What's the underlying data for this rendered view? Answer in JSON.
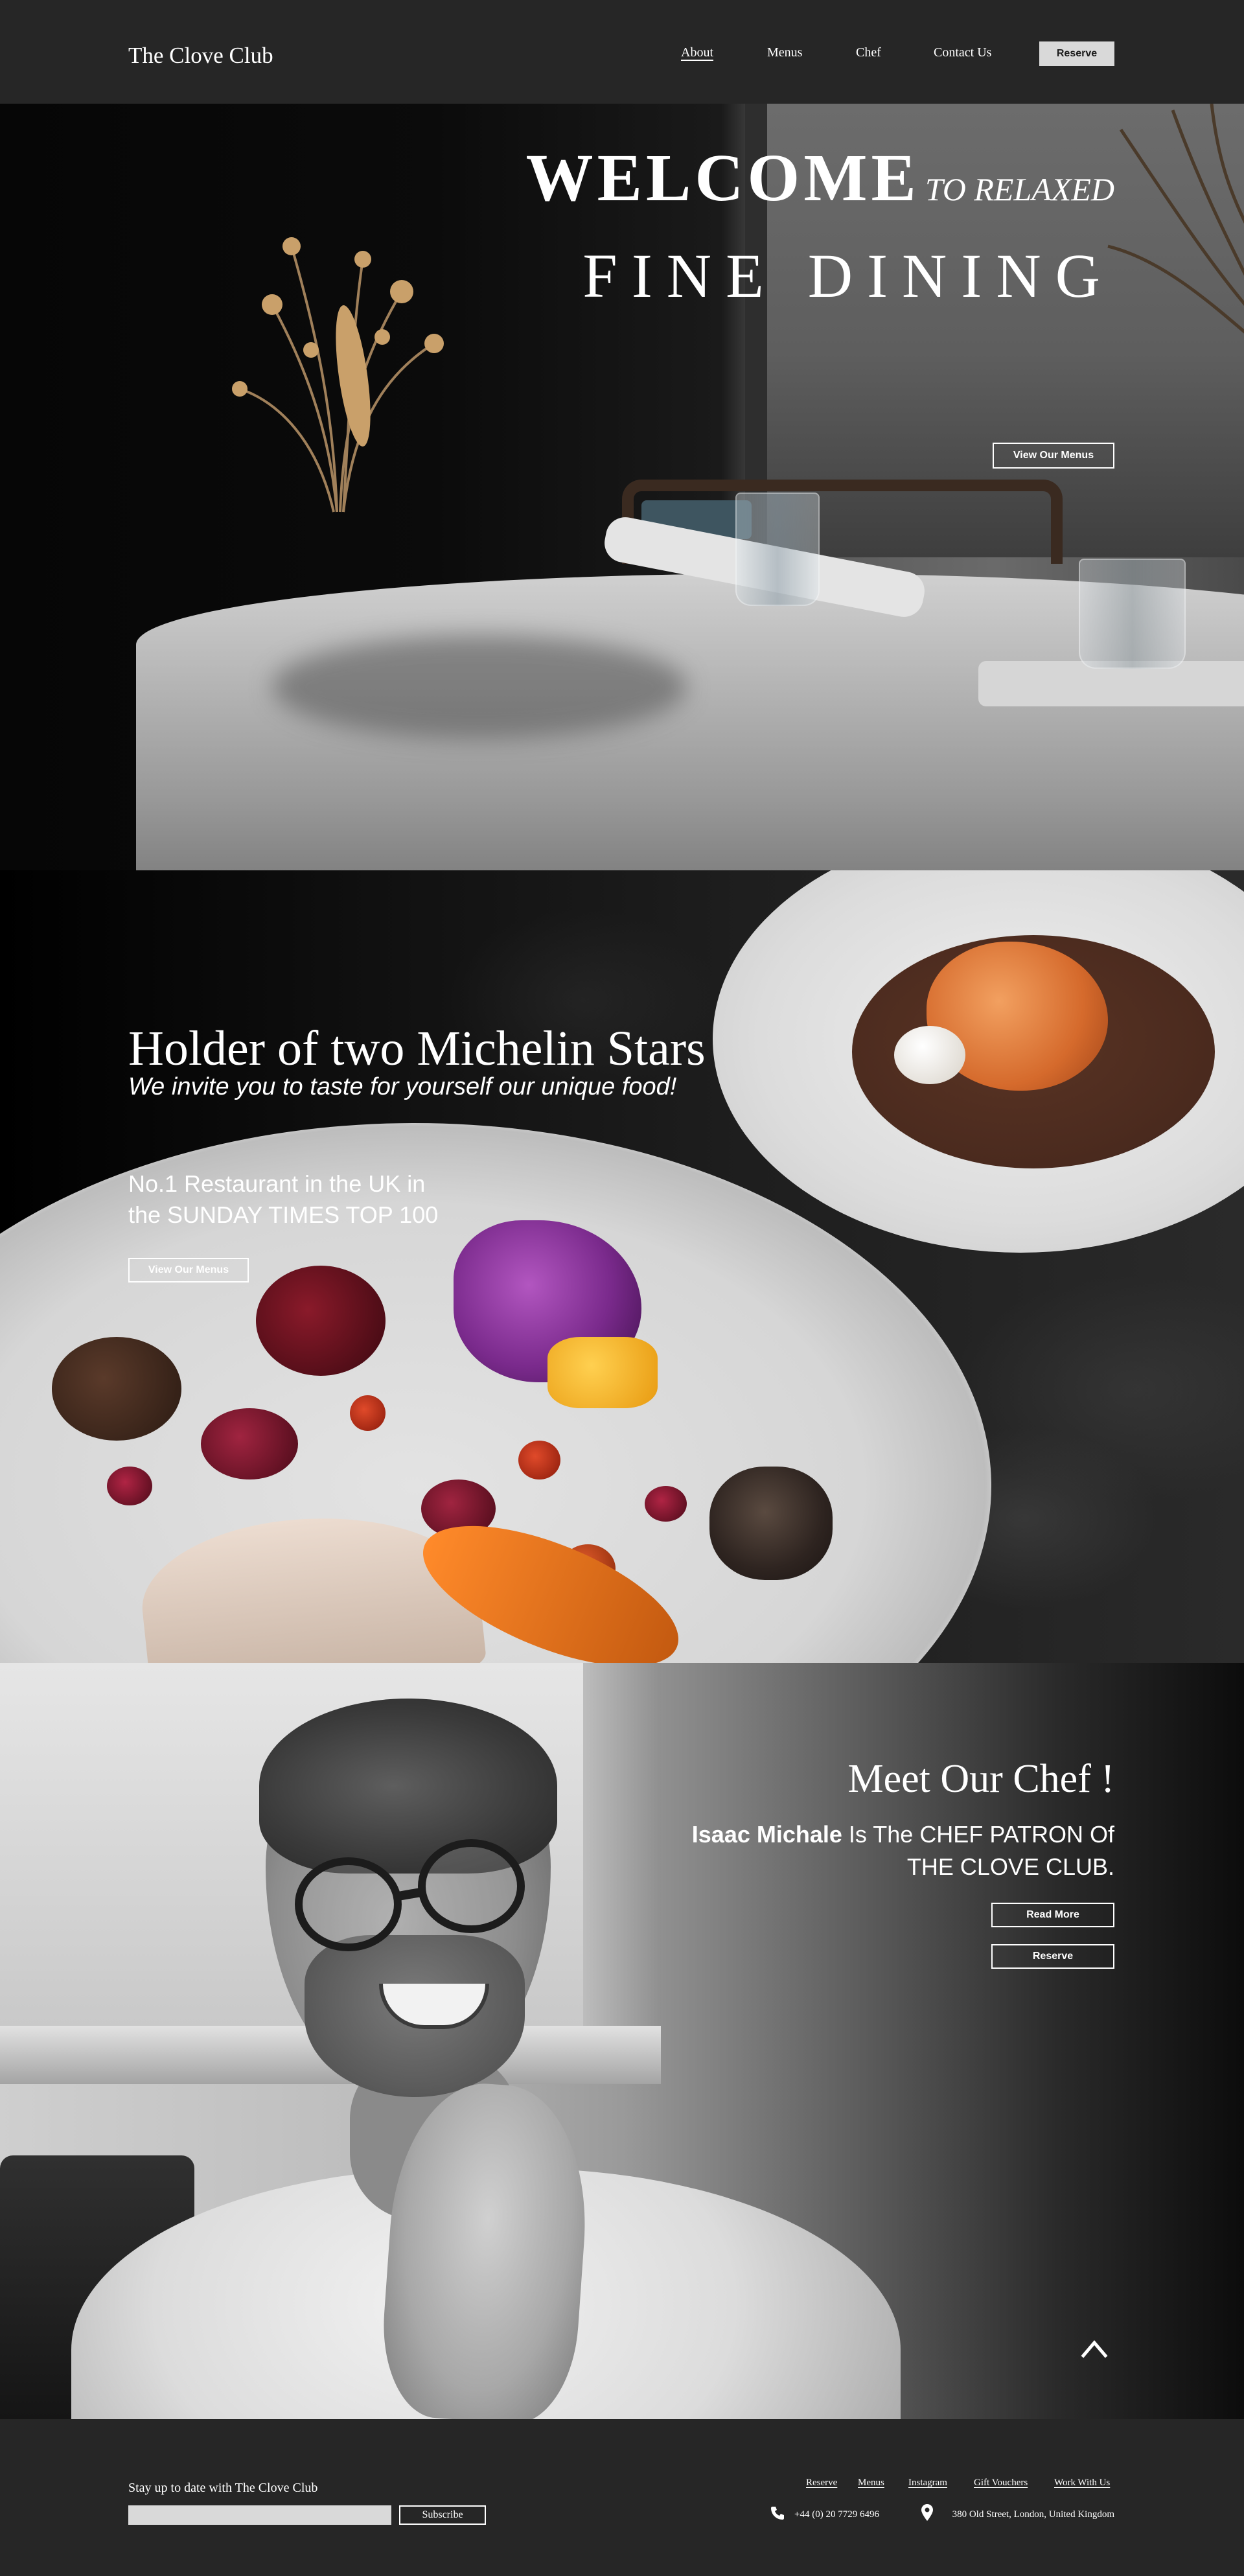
{
  "header": {
    "logo": "The Clove Club",
    "nav": [
      "About",
      "Menus",
      "Chef",
      "Contact Us"
    ],
    "reserve_label": "Reserve"
  },
  "hero": {
    "welcome": "WELCOME",
    "welcome_suffix": "TO RELAXED",
    "fine_dining": "FINE DINING",
    "button_label": "View Our Menus"
  },
  "michelin": {
    "title": "Holder of two Michelin Stars",
    "subtitle": "We invite you to taste for yourself our unique food!",
    "line1": "No.1 Restaurant in the UK in",
    "line2": "the SUNDAY TIMES TOP 100",
    "button_label": "View Our Menus"
  },
  "chef": {
    "title": "Meet Our Chef !",
    "name": "Isaac Michale",
    "line1_rest": " Is The CHEF PATRON Of",
    "line2": "THE CLOVE CLUB.",
    "read_more_label": "Read More",
    "reserve_label": "Reserve",
    "scroll_top_icon": "chevron-up-icon"
  },
  "footer": {
    "subscribe_label": "Stay up to date with The Clove Club",
    "subscribe_input_value": "",
    "subscribe_button": "Subscribe",
    "links": [
      "Reserve",
      "Menus",
      "Instagram",
      "Gift Vouchers",
      "Work With Us"
    ],
    "phone": "+44 (0) 20 7729 6496",
    "address": "380 Old Street, London, United Kingdom",
    "phone_icon": "phone-icon",
    "address_icon": "location-pin-icon"
  },
  "colors": {
    "header_bg": "#262626",
    "reserve_button_bg": "#d9d9d9",
    "text": "#ffffff"
  }
}
